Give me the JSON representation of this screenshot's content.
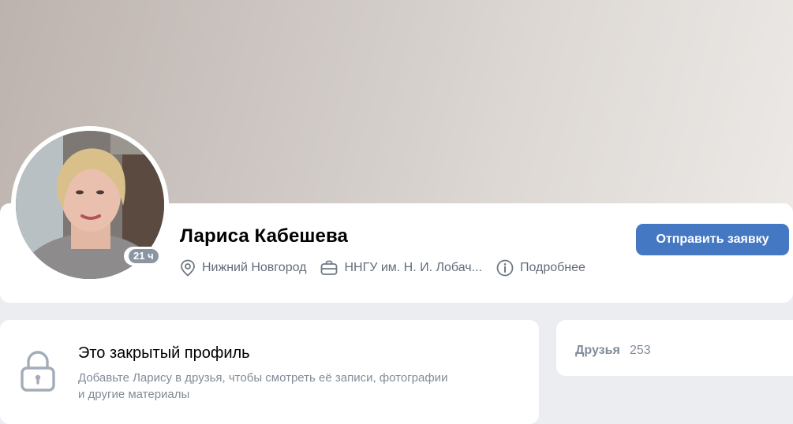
{
  "profile": {
    "name": "Лариса Кабешева",
    "online_badge": "21 ч",
    "city": "Нижний Новгород",
    "work": "ННГУ им. Н. И. Лобач...",
    "more_label": "Подробнее",
    "send_request_label": "Отправить заявку"
  },
  "private_profile": {
    "title": "Это закрытый профиль",
    "description": "Добавьте Ларису в друзья, чтобы смотреть её записи, фотографии и другие материалы"
  },
  "friends": {
    "label": "Друзья",
    "count": "253"
  },
  "icons": {
    "city": "location-pin-icon",
    "work": "briefcase-icon",
    "more": "info-icon",
    "private": "lock-icon"
  },
  "colors": {
    "accent": "#4478c3",
    "secondary_text": "#818c99",
    "page_bg": "#ebedf0"
  }
}
